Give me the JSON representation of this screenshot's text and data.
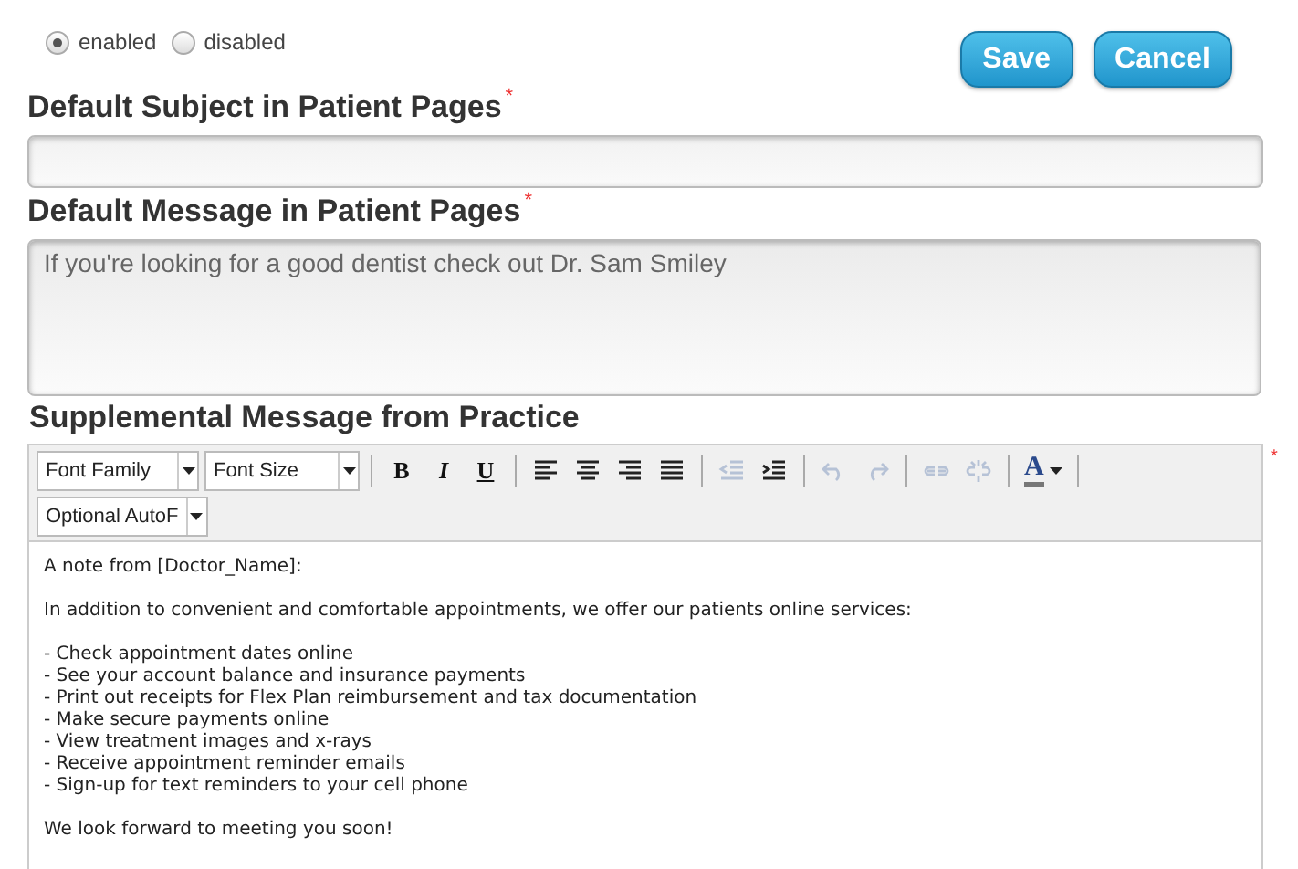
{
  "status_options": [
    {
      "label": "enabled",
      "selected": true
    },
    {
      "label": "disabled",
      "selected": false
    }
  ],
  "buttons": [
    "Save",
    "Cancel"
  ],
  "subject": {
    "label": "Default Subject in Patient Pages",
    "required_mark": "*"
  },
  "message": {
    "label": "Default Message in Patient Pages",
    "required_mark": "*",
    "value": "If you're looking for a good dentist check out Dr. Sam Smiley"
  },
  "supplemental": {
    "label": "Supplemental Message from Practice",
    "required_mark": "*",
    "toolbar_rows": [
      [
        {
          "kind": "select",
          "label": "Font Family"
        },
        {
          "kind": "select",
          "label": "Font Size"
        },
        {
          "kind": "separator"
        },
        {
          "kind": "bold",
          "label": "B"
        },
        {
          "kind": "italic",
          "label": "I"
        },
        {
          "kind": "underline",
          "label": "U"
        },
        {
          "kind": "separator"
        },
        {
          "kind": "alignleft",
          "disabled": false
        },
        {
          "kind": "aligncenter",
          "disabled": false
        },
        {
          "kind": "alignright",
          "disabled": false
        },
        {
          "kind": "justify",
          "disabled": false
        },
        {
          "kind": "separator"
        },
        {
          "kind": "outdent",
          "disabled": true
        },
        {
          "kind": "indent",
          "disabled": false
        },
        {
          "kind": "separator"
        },
        {
          "kind": "undo",
          "disabled": true
        },
        {
          "kind": "redo",
          "disabled": true
        },
        {
          "kind": "separator"
        },
        {
          "kind": "link",
          "disabled": true
        },
        {
          "kind": "unlink",
          "disabled": true
        },
        {
          "kind": "separator"
        },
        {
          "kind": "color",
          "label": "A"
        },
        {
          "kind": "separator"
        }
      ],
      [
        {
          "kind": "select",
          "label": "Optional AutoF"
        }
      ]
    ],
    "paragraphs": [
      [
        "A note from [Doctor_Name]:"
      ],
      [
        "In addition to convenient and comfortable appointments, we offer our patients online services:"
      ],
      [
        "- Check appointment dates online",
        "- See your account balance and insurance payments",
        "- Print out receipts for Flex Plan reimbursement and tax documentation",
        "- Make secure payments online",
        "- View treatment images and x-rays",
        "- Receive appointment reminder emails",
        "- Sign-up for text reminders to your cell phone"
      ],
      [
        "We look forward to meeting you soon!"
      ]
    ]
  }
}
